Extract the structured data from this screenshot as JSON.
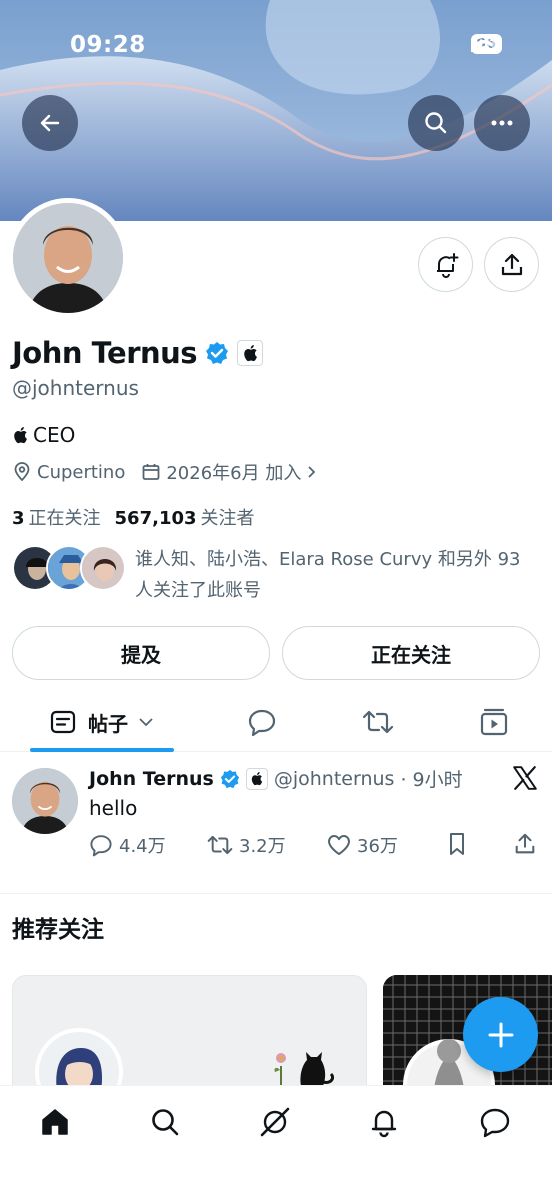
{
  "status_bar": {
    "time": "09:28",
    "battery": "96"
  },
  "header": {
    "back_icon": "arrow-left-icon",
    "search_icon": "search-icon",
    "more_icon": "more-horizontal-icon"
  },
  "profile": {
    "name": "John Ternus",
    "handle": "@johnternus",
    "bio": "CEO",
    "location": "Cupertino",
    "joined": "2026年6月 加入",
    "following_count": "3",
    "following_label": "正在关注",
    "followers_count": "567,103",
    "followers_label": "关注者",
    "known_followers_text": "谁人知、陆小浩、Elara Rose Curvy 和另外 93 人关注了此账号",
    "mention_button": "提及",
    "following_button": "正在关注",
    "verified_color": "#1d9bf0"
  },
  "tabs": {
    "posts_label": "帖子"
  },
  "post": {
    "name": "John Ternus",
    "handle": "@johnternus",
    "time": "· 9小时",
    "text": "hello",
    "replies": "4.4万",
    "reposts": "3.2万",
    "likes": "36万"
  },
  "recommended": {
    "title": "推荐关注"
  },
  "colors": {
    "accent": "#1d9bf0",
    "text": "#0f1419",
    "muted": "#536471"
  }
}
